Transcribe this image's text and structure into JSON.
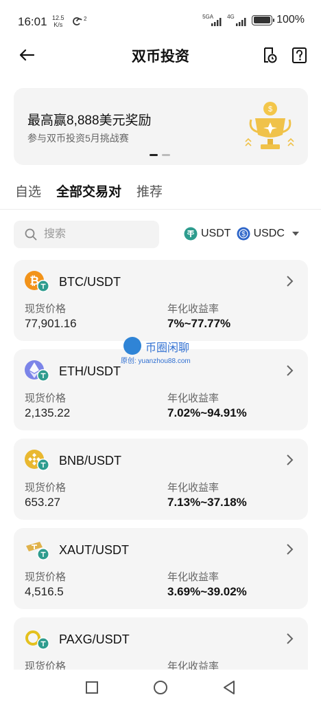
{
  "status_bar": {
    "time": "16:01",
    "speed_value": "12.5",
    "speed_unit": "K/s",
    "net1": "5GA",
    "net2": "4G",
    "battery": "100%"
  },
  "header": {
    "title": "双币投资",
    "icons": [
      "back-arrow-icon",
      "order-history-icon",
      "help-icon"
    ]
  },
  "banner": {
    "title": "最高赢8,888美元奖励",
    "subtitle": "参与双币投资5月挑战赛",
    "page_count": 2,
    "active_page": 1
  },
  "tabs": [
    {
      "label": "自选",
      "active": false
    },
    {
      "label": "全部交易对",
      "active": true
    },
    {
      "label": "推荐",
      "active": false
    }
  ],
  "search": {
    "placeholder": "搜索"
  },
  "filter": {
    "options": [
      {
        "label": "USDT",
        "color": "#2e9c8e"
      },
      {
        "label": "USDC",
        "color": "#2e66c9"
      }
    ]
  },
  "labels": {
    "price": "现货价格",
    "yield": "年化收益率"
  },
  "pairs": [
    {
      "pair": "BTC/USDT",
      "price": "77,901.16",
      "yield": "7%~77.77%",
      "icon": "btc-icon",
      "color": "#f2931a"
    },
    {
      "pair": "ETH/USDT",
      "price": "2,135.22",
      "yield": "7.02%~94.91%",
      "icon": "eth-icon",
      "color": "#7b84e8"
    },
    {
      "pair": "BNB/USDT",
      "price": "653.27",
      "yield": "7.13%~37.18%",
      "icon": "bnb-icon",
      "color": "#e9b830"
    },
    {
      "pair": "XAUT/USDT",
      "price": "4,516.5",
      "yield": "3.69%~39.02%",
      "icon": "xaut-icon",
      "color": "#e0b24a"
    },
    {
      "pair": "PAXG/USDT",
      "price": "",
      "yield": "",
      "icon": "paxg-icon",
      "color": "#e4c11e"
    }
  ],
  "watermark": {
    "title": "币圈闲聊",
    "subtitle": "原创: yuanzhou88.com"
  }
}
